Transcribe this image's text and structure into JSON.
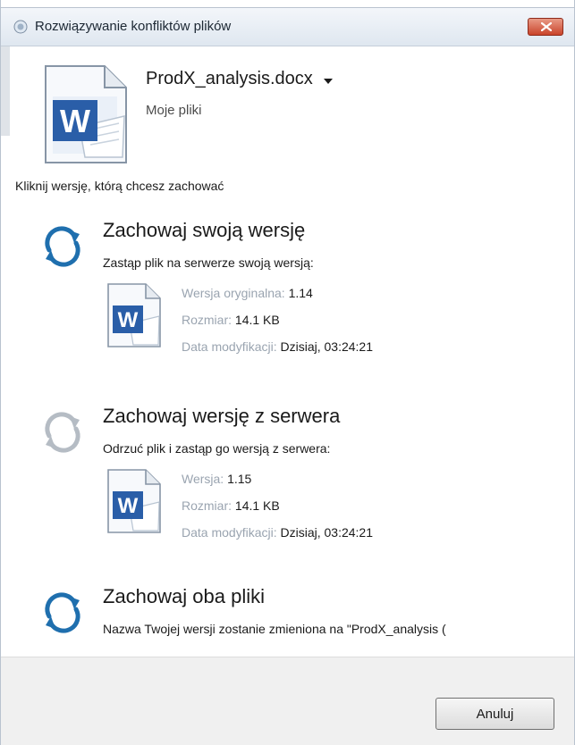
{
  "window": {
    "title": "Rozwiązywanie konfliktów plików"
  },
  "file": {
    "name": "ProdX_analysis.docx",
    "location": "Moje pliki",
    "icon": "word-document-icon"
  },
  "instruction": "Kliknij wersję, którą chcesz zachować",
  "options": [
    {
      "title": "Zachowaj swoją wersję",
      "description": "Zastąp plik na serwerze swoją wersją:",
      "meta": [
        {
          "key": "Wersja oryginalna:",
          "value": "1.14"
        },
        {
          "key": "Rozmiar:",
          "value": "14.1 KB"
        },
        {
          "key": "Data modyfikacji:",
          "value": "Dzisiaj, 03:24:21"
        }
      ]
    },
    {
      "title": "Zachowaj wersję z serwera",
      "description": "Odrzuć plik i zastąp go wersją z serwera:",
      "meta": [
        {
          "key": "Wersja:",
          "value": "1.15"
        },
        {
          "key": "Rozmiar:",
          "value": "14.1 KB"
        },
        {
          "key": "Data modyfikacji:",
          "value": "Dzisiaj, 03:24:21"
        }
      ]
    },
    {
      "title": "Zachowaj oba pliki",
      "description": "Nazwa Twojej wersji zostanie zmieniona na \"ProdX_analysis ("
    }
  ],
  "footer": {
    "cancel_label": "Anuluj"
  },
  "colors": {
    "sync_active": "#1f6fae",
    "sync_inactive": "#b5bcc4",
    "meta_key": "#9aa4b0",
    "word_blue": "#2a5ea8"
  }
}
